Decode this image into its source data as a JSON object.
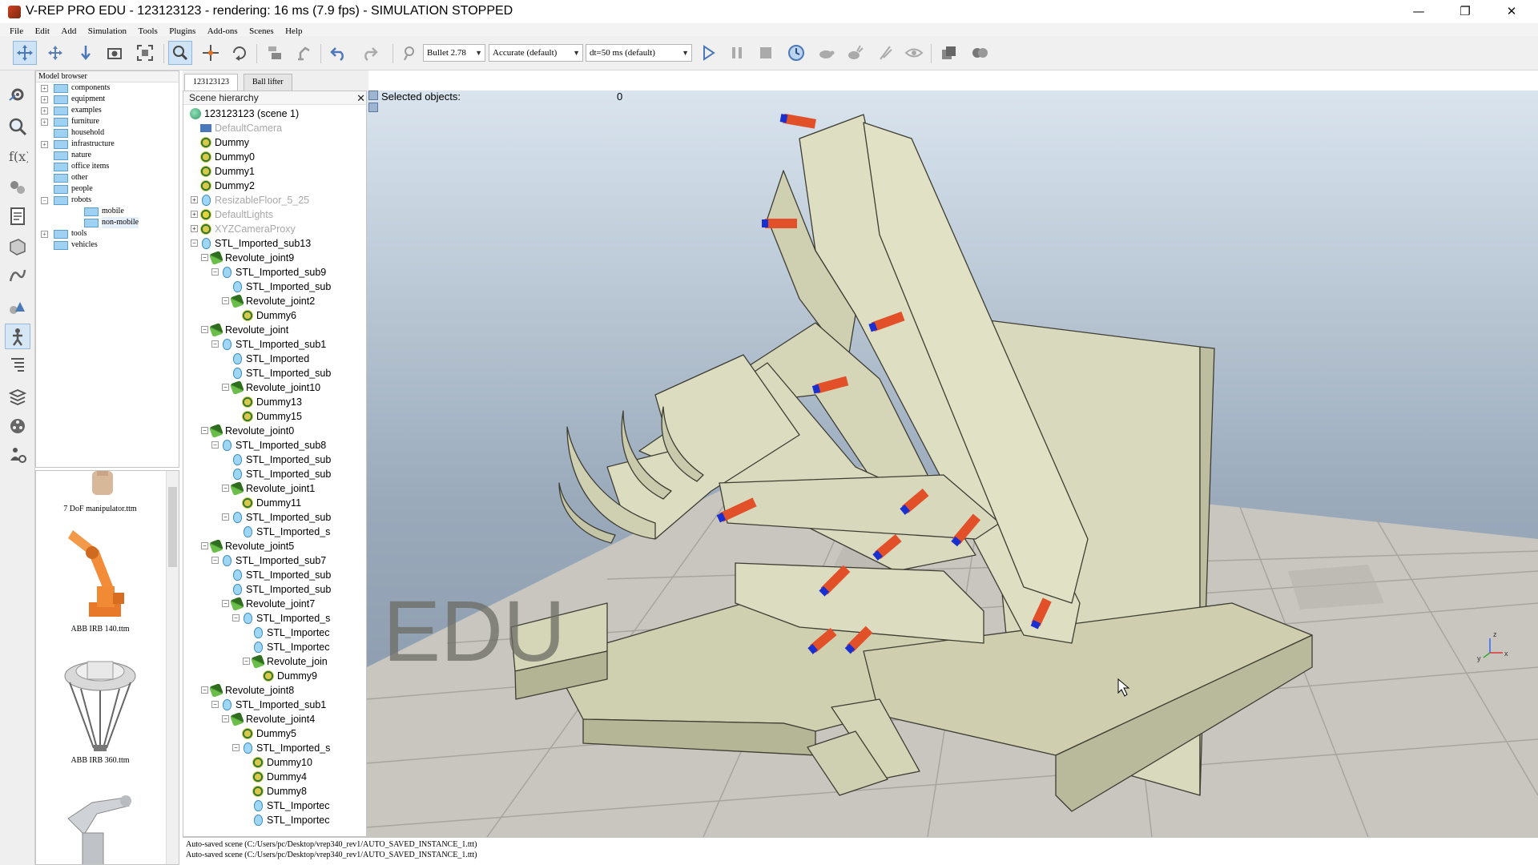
{
  "window": {
    "title": "V-REP PRO EDU - 123123123 - rendering: 16 ms (7.9 fps) - SIMULATION STOPPED",
    "minimize": "—",
    "maximize": "❐",
    "close": "✕"
  },
  "menu": [
    "File",
    "Edit",
    "Add",
    "Simulation",
    "Tools",
    "Plugins",
    "Add-ons",
    "Scenes",
    "Help"
  ],
  "toolbar": {
    "engine": "Bullet 2.78",
    "accuracy": "Accurate (default)",
    "timestep": "dt=50 ms (default)"
  },
  "model_browser": {
    "title": "Model browser",
    "items": [
      {
        "label": "components",
        "expandable": true
      },
      {
        "label": "equipment",
        "expandable": true
      },
      {
        "label": "examples",
        "expandable": true
      },
      {
        "label": "furniture",
        "expandable": true
      },
      {
        "label": "household",
        "expandable": false
      },
      {
        "label": "infrastructure",
        "expandable": true
      },
      {
        "label": "nature",
        "expandable": false
      },
      {
        "label": "office items",
        "expandable": false
      },
      {
        "label": "other",
        "expandable": false
      },
      {
        "label": "people",
        "expandable": false
      },
      {
        "label": "robots",
        "expandable": true,
        "expanded": true
      },
      {
        "label": "mobile",
        "child": true
      },
      {
        "label": "non-mobile",
        "child": true,
        "selected": true
      },
      {
        "label": "tools",
        "expandable": true
      },
      {
        "label": "vehicles",
        "expandable": false
      }
    ],
    "thumbnails": [
      "7 DoF manipulator.ttm",
      "ABB IRB 140.ttm",
      "ABB IRB 360.ttm"
    ]
  },
  "scene_tabs": [
    "123123123",
    "Ball lifter"
  ],
  "hierarchy": {
    "title": "Scene hierarchy",
    "rows": [
      {
        "label": "123123123 (scene 1)",
        "depth": 0,
        "icon": "scene-icon",
        "ex": ""
      },
      {
        "label": "DefaultCamera",
        "depth": 1,
        "icon": "camera-icon",
        "grey": true
      },
      {
        "label": "Dummy",
        "depth": 1,
        "icon": "dummy-icon"
      },
      {
        "label": "Dummy0",
        "depth": 1,
        "icon": "dummy-icon"
      },
      {
        "label": "Dummy1",
        "depth": 1,
        "icon": "dummy-icon"
      },
      {
        "label": "Dummy2",
        "depth": 1,
        "icon": "dummy-icon"
      },
      {
        "label": "ResizableFloor_5_25",
        "depth": 1,
        "icon": "shape-icon",
        "grey": true,
        "ex": "+"
      },
      {
        "label": "DefaultLights",
        "depth": 1,
        "icon": "light-icon",
        "grey": true,
        "ex": "+"
      },
      {
        "label": "XYZCameraProxy",
        "depth": 1,
        "icon": "dummy-icon",
        "grey": true,
        "ex": "+"
      },
      {
        "label": "STL_Imported_sub13",
        "depth": 1,
        "icon": "shape-icon",
        "ex": "-"
      },
      {
        "label": "Revolute_joint9",
        "depth": 2,
        "icon": "joint-icon",
        "ex": "-"
      },
      {
        "label": "STL_Imported_sub9",
        "depth": 3,
        "icon": "shape-icon",
        "ex": "-"
      },
      {
        "label": "STL_Imported_sub",
        "depth": 4,
        "icon": "shape-icon"
      },
      {
        "label": "Revolute_joint2",
        "depth": 4,
        "icon": "joint-icon",
        "ex": "-"
      },
      {
        "label": "Dummy6",
        "depth": 5,
        "icon": "dummy-icon"
      },
      {
        "label": "Revolute_joint",
        "depth": 2,
        "icon": "joint-icon",
        "ex": "-"
      },
      {
        "label": "STL_Imported_sub1",
        "depth": 3,
        "icon": "shape-icon",
        "ex": "-"
      },
      {
        "label": "STL_Imported",
        "depth": 4,
        "icon": "shape-icon"
      },
      {
        "label": "STL_Imported_sub",
        "depth": 4,
        "icon": "shape-icon"
      },
      {
        "label": "Revolute_joint10",
        "depth": 4,
        "icon": "joint-icon",
        "ex": "-"
      },
      {
        "label": "Dummy13",
        "depth": 5,
        "icon": "dummy-icon"
      },
      {
        "label": "Dummy15",
        "depth": 5,
        "icon": "dummy-icon"
      },
      {
        "label": "Revolute_joint0",
        "depth": 2,
        "icon": "joint-icon",
        "ex": "-"
      },
      {
        "label": "STL_Imported_sub8",
        "depth": 3,
        "icon": "shape-icon",
        "ex": "-"
      },
      {
        "label": "STL_Imported_sub",
        "depth": 4,
        "icon": "shape-icon"
      },
      {
        "label": "STL_Imported_sub",
        "depth": 4,
        "icon": "shape-icon"
      },
      {
        "label": "Revolute_joint1",
        "depth": 4,
        "icon": "joint-icon",
        "ex": "-"
      },
      {
        "label": "Dummy11",
        "depth": 5,
        "icon": "dummy-icon"
      },
      {
        "label": "STL_Imported_sub",
        "depth": 4,
        "icon": "shape-icon",
        "ex": "-"
      },
      {
        "label": "STL_Imported_s",
        "depth": 5,
        "icon": "shape-icon"
      },
      {
        "label": "Revolute_joint5",
        "depth": 2,
        "icon": "joint-icon",
        "ex": "-"
      },
      {
        "label": "STL_Imported_sub7",
        "depth": 3,
        "icon": "shape-icon",
        "ex": "-"
      },
      {
        "label": "STL_Imported_sub",
        "depth": 4,
        "icon": "shape-icon"
      },
      {
        "label": "STL_Imported_sub",
        "depth": 4,
        "icon": "shape-icon"
      },
      {
        "label": "Revolute_joint7",
        "depth": 4,
        "icon": "joint-icon",
        "ex": "-"
      },
      {
        "label": "STL_Imported_s",
        "depth": 5,
        "icon": "shape-icon",
        "ex": "-"
      },
      {
        "label": "STL_Importec",
        "depth": 6,
        "icon": "shape-icon"
      },
      {
        "label": "STL_Importec",
        "depth": 6,
        "icon": "shape-icon"
      },
      {
        "label": "Revolute_join",
        "depth": 6,
        "icon": "joint-icon",
        "ex": "-"
      },
      {
        "label": "Dummy9",
        "depth": 7,
        "icon": "dummy-icon"
      },
      {
        "label": "Revolute_joint8",
        "depth": 2,
        "icon": "joint-icon",
        "ex": "-"
      },
      {
        "label": "STL_Imported_sub1",
        "depth": 3,
        "icon": "shape-icon",
        "ex": "-"
      },
      {
        "label": "Revolute_joint4",
        "depth": 4,
        "icon": "joint-icon",
        "ex": "-"
      },
      {
        "label": "Dummy5",
        "depth": 5,
        "icon": "dummy-icon"
      },
      {
        "label": "STL_Imported_s",
        "depth": 5,
        "icon": "shape-icon",
        "ex": "-"
      },
      {
        "label": "Dummy10",
        "depth": 6,
        "icon": "dummy-icon"
      },
      {
        "label": "Dummy4",
        "depth": 6,
        "icon": "dummy-icon"
      },
      {
        "label": "Dummy8",
        "depth": 6,
        "icon": "dummy-icon"
      },
      {
        "label": "STL_Importec",
        "depth": 6,
        "icon": "shape-icon"
      },
      {
        "label": "STL_Importec",
        "depth": 6,
        "icon": "shape-icon"
      }
    ]
  },
  "viewport": {
    "selected_label": "Selected objects:",
    "selected_value": "0",
    "watermark": "EDU",
    "axis_x": "x",
    "axis_y": "y",
    "axis_z": "z"
  },
  "status": {
    "lines": [
      "Auto-saved scene (C:/Users/pc/Desktop/vrep340_rev1/AUTO_SAVED_INSTANCE_1.ttt)",
      "Auto-saved scene (C:/Users/pc/Desktop/vrep340_rev1/AUTO_SAVED_INSTANCE_1.ttt)"
    ]
  }
}
